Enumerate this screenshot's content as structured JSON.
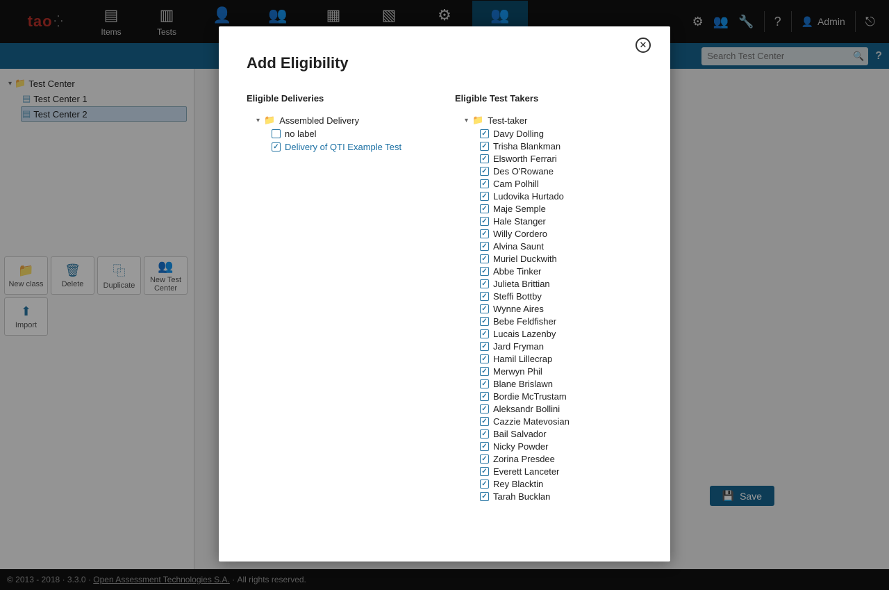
{
  "header": {
    "logo": "tao",
    "nav": [
      {
        "label": "Items"
      },
      {
        "label": "Tests"
      },
      {
        "label": ""
      },
      {
        "label": ""
      },
      {
        "label": ""
      },
      {
        "label": ""
      },
      {
        "label": ""
      },
      {
        "label": ""
      }
    ],
    "admin_label": "Admin"
  },
  "search": {
    "placeholder": "Search Test Center"
  },
  "tree": {
    "root": "Test Center",
    "children": [
      "Test Center 1",
      "Test Center 2"
    ],
    "selected_index": 1
  },
  "actions": [
    {
      "label": "New class"
    },
    {
      "label": "Delete"
    },
    {
      "label": "Duplicate"
    },
    {
      "label": "New Test Center"
    },
    {
      "label": "Import"
    }
  ],
  "save_label": "Save",
  "footer": {
    "copyright": "© 2013 - 2018",
    "version": "3.3.0",
    "link": "Open Assessment Technologies S.A.",
    "rights": "All rights reserved."
  },
  "modal": {
    "title": "Add Eligibility",
    "col1_title": "Eligible Deliveries",
    "col2_title": "Eligible Test Takers",
    "deliveries": {
      "folder": "Assembled Delivery",
      "items": [
        {
          "label": "no label",
          "checked": false
        },
        {
          "label": "Delivery of QTI Example Test",
          "checked": true
        }
      ]
    },
    "testtakers": {
      "folder": "Test-taker",
      "items": [
        "Davy Dolling",
        "Trisha Blankman",
        "Elsworth Ferrari",
        "Des O'Rowane",
        "Cam Polhill",
        "Ludovika Hurtado",
        "Maje Semple",
        "Hale Stanger",
        "Willy Cordero",
        "Alvina Saunt",
        "Muriel Duckwith",
        "Abbe Tinker",
        "Julieta Brittian",
        "Steffi Bottby",
        "Wynne Aires",
        "Bebe Feldfisher",
        "Lucais Lazenby",
        "Jard Fryman",
        "Hamil Lillecrap",
        "Merwyn Phil",
        "Blane Brislawn",
        "Bordie McTrustam",
        "Aleksandr Bollini",
        "Cazzie Matevosian",
        "Bail Salvador",
        "Nicky Powder",
        "Zorina Presdee",
        "Everett Lanceter",
        "Rey Blacktin",
        "Tarah Bucklan"
      ]
    }
  }
}
